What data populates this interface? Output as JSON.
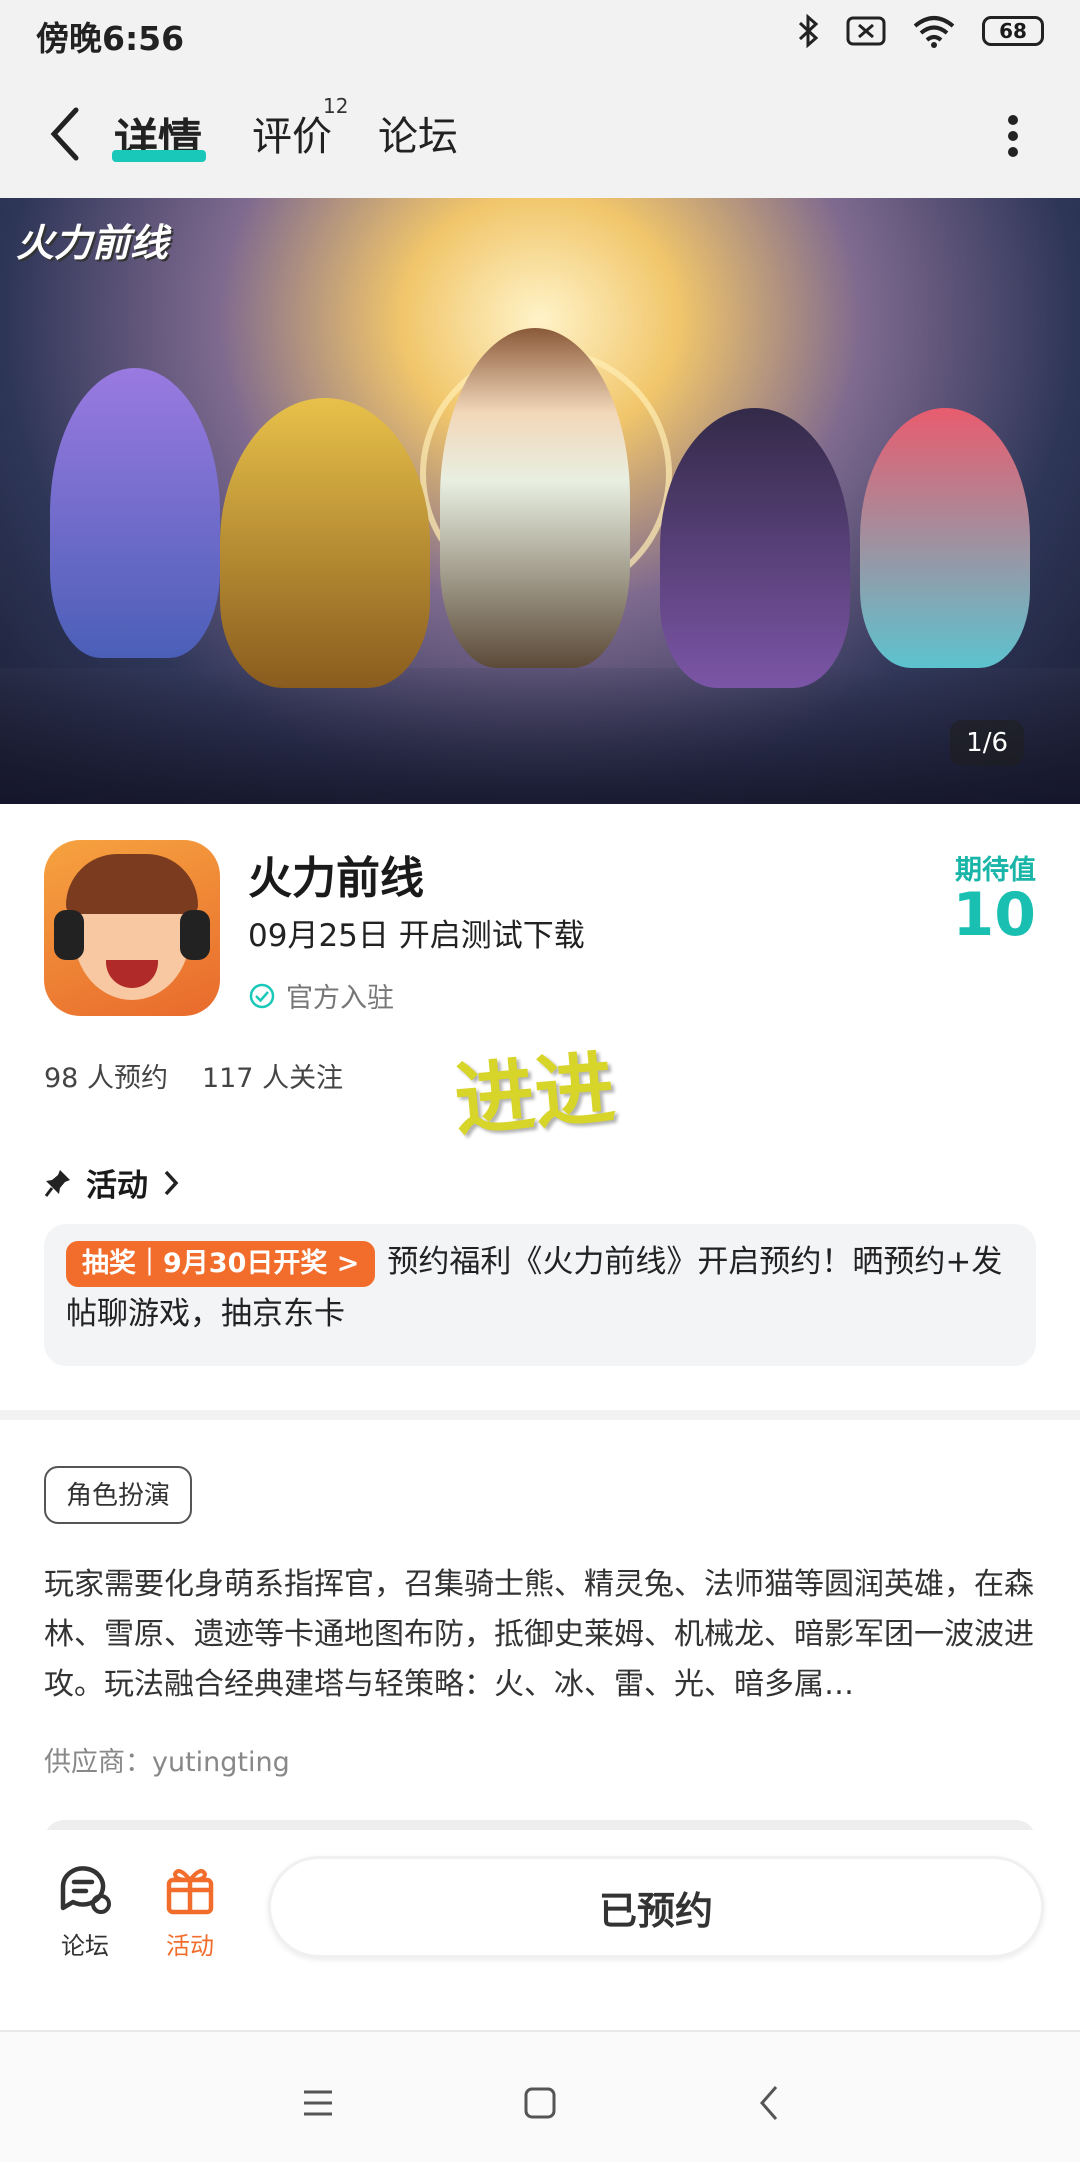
{
  "status_bar": {
    "time": "傍晚6:56",
    "battery": "68"
  },
  "header": {
    "tabs": [
      {
        "label": "详情",
        "active": true
      },
      {
        "label": "评价",
        "count": "12"
      },
      {
        "label": "论坛"
      }
    ]
  },
  "banner": {
    "logo_text": "火力前线",
    "counter": "1/6"
  },
  "app": {
    "title": "火力前线",
    "subtitle": "09月25日 开启测试下载",
    "official": "官方入驻",
    "expect_label": "期待值",
    "expect_value": "10",
    "reservations": "98 人预约",
    "followers": "117 人关注",
    "sticker": "进进"
  },
  "activity": {
    "heading": "活动",
    "tag": "抽奖｜9月30日开奖 >",
    "text": "预约福利《火力前线》开启预约！晒预约+发帖聊游戏，抽京东卡"
  },
  "details": {
    "genre": "角色扮演",
    "description": "玩家需要化身萌系指挥官，召集骑士熊、精灵兔、法师猫等圆润英雄，在森林、雪原、遗迹等卡通地图布防，抵御史莱姆、机械龙、暗影军团一波波进攻。玩法融合经典建塔与轻策略：火、冰、雷、光、暗多属…",
    "supplier": "供应商：yutingting"
  },
  "bottom_bar": {
    "forum_label": "论坛",
    "activity_label": "活动",
    "reserved_label": "已预约"
  },
  "colors": {
    "accent": "#19c8b9",
    "orange": "#f26c2b"
  }
}
